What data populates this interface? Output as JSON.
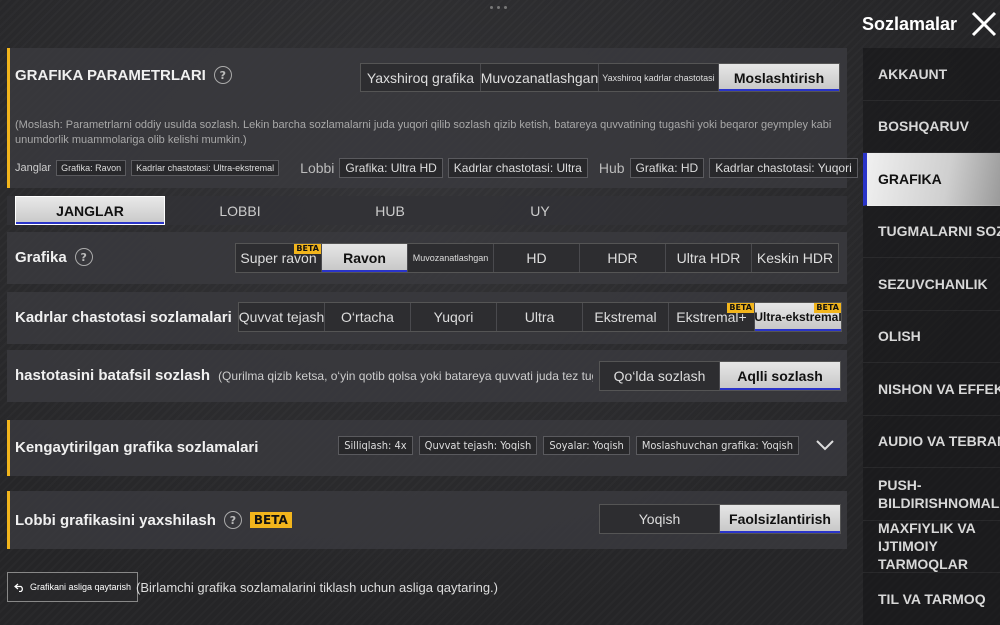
{
  "header": {
    "title": "Sozlamalar"
  },
  "sidebar": {
    "items": [
      {
        "label": "AKKAUNT"
      },
      {
        "label": "BOSHQARUV"
      },
      {
        "label": "GRAFIKA"
      },
      {
        "label": "TUGMALARNI SOZLA"
      },
      {
        "label": "SEZUVCHANLIK"
      },
      {
        "label": "OLISH"
      },
      {
        "label": "NISHON VA EFFEKTL"
      },
      {
        "label": "AUDIO VA TEBRANIS"
      },
      {
        "label": "PUSH-BILDIRISHNOMALAR"
      },
      {
        "label": "MAXFIYLIK VA IJTIMOIY TARMOQLAR"
      },
      {
        "label": "TIL VA TARMOQ"
      }
    ],
    "active_index": 2
  },
  "params": {
    "title": "GRAFIKA PARAMETRLARI",
    "modes": [
      "Yaxshiroq grafika",
      "Muvozanatlashgan",
      "Yaxshiroq kadrlar chastotasi",
      "Moslashtirish"
    ],
    "selected_mode": "Moslashtirish",
    "description": "(Moslash: Parametrlarni oddiy usulda sozlash. Lekin barcha sozlamalarni juda yuqori qilib sozlash qizib ketish, batareya quvvatining tugashi yoki beqaror geympley kabi unumdorlik muammolariga olib kelishi mumkin.)",
    "presets": {
      "janglar_label": "Janglar",
      "janglar_chips": [
        "Grafika: Ravon",
        "Kadrlar chastotasi: Ultra-ekstremal"
      ],
      "lobbi_label": "Lobbi",
      "lobbi_chips": [
        "Grafika: Ultra HD",
        "Kadrlar chastotasi: Ultra"
      ],
      "hub_label": "Hub",
      "hub_chips": [
        "Grafika: HD",
        "Kadrlar chastotasi: Yuqori"
      ]
    }
  },
  "tabs": [
    "JANGLAR",
    "LOBBI",
    "HUB",
    "UY"
  ],
  "selected_tab": "JANGLAR",
  "grafika": {
    "label": "Grafika",
    "options": [
      "Super ravon",
      "Ravon",
      "Muvozanatlashgan",
      "HD",
      "HDR",
      "Ultra HDR",
      "Keskin HDR"
    ],
    "selected": "Ravon",
    "beta_text": "BETA"
  },
  "fps": {
    "label": "Kadrlar chastotasi sozlamalari",
    "options": [
      "Quvvat tejash",
      "O‘rtacha",
      "Yuqori",
      "Ultra",
      "Ekstremal",
      "Ekstremal+",
      "Ultra-ekstremal"
    ],
    "selected": "Ultra-ekstremal",
    "beta_text": "BETA"
  },
  "detail": {
    "label": "hastotasini batafsil sozlash",
    "hint": "(Qurilma qizib ketsa, o‘yin qotib qolsa yoki batareya quvvati juda tez tugasa, bu sozl",
    "options": [
      "Qo‘lda sozlash",
      "Aqlli sozlash"
    ],
    "selected": "Aqlli sozlash"
  },
  "advanced": {
    "label": "Kengaytirilgan grafika sozlamalari",
    "chips": [
      "Silliqlash: 4x",
      "Quvvat tejash: Yoqish",
      "Soyalar: Yoqish",
      "Moslashuvchan grafika: Yoqish"
    ]
  },
  "lobby_enhance": {
    "label": "Lobbi grafikasini yaxshilash",
    "beta": "BETA",
    "options": [
      "Yoqish",
      "Faolsizlantirish"
    ],
    "selected": "Faolsizlantirish"
  },
  "reset": {
    "button": "Grafikani asliga qaytarish",
    "hint": "(Birlamchi grafika sozlamalarini tiklash uchun asliga qaytaring.)"
  },
  "colors": {
    "accent": "#f2b51c",
    "selected_underline": "#2a34c9"
  }
}
